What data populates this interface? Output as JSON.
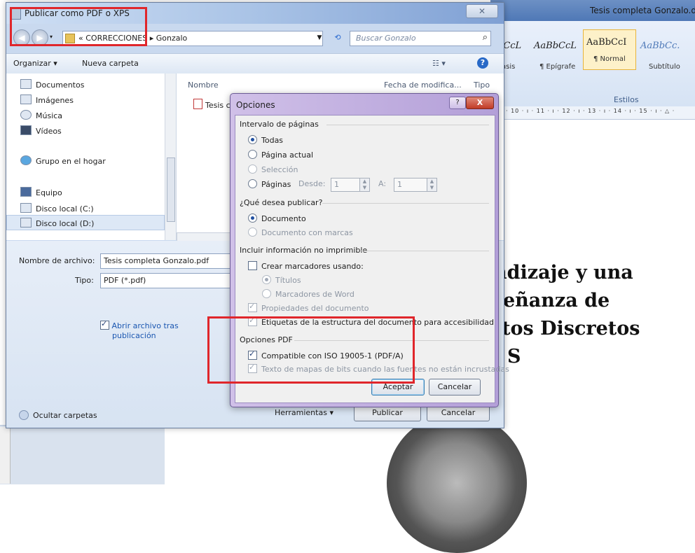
{
  "word": {
    "title": "Tesis completa Gonzalo.doc",
    "styles": [
      {
        "sample": "bCcL",
        "name": "asis"
      },
      {
        "sample": "AaBbCcL",
        "name": "¶ Epígrafe"
      },
      {
        "sample": "AaBbCcI",
        "name": "¶ Normal"
      },
      {
        "sample": "AaBbCc.",
        "name": "Subtítulo"
      }
    ],
    "styles_group": "Estilos",
    "ruler": "· 10 · ı · 11 · ı · 12 · ı · 13 · ı · 14 · ı · 15 · ı · △ ·",
    "heading_lines": [
      "ndizaje y una",
      "eñanza de",
      "tos Discretos",
      "S"
    ]
  },
  "save_dialog": {
    "title": "Publicar como PDF o XPS",
    "close": "✕",
    "breadcrumb": "« CORRECCIONES ▸ Gonzalo",
    "search_placeholder": "Buscar Gonzalo",
    "toolbar": {
      "organize": "Organizar ▾",
      "new_folder": "Nueva carpeta",
      "view": "☷ ▾",
      "help": "?"
    },
    "nav": [
      {
        "label": "Documentos",
        "icon": "documents-icon"
      },
      {
        "label": "Imágenes",
        "icon": "pictures-icon"
      },
      {
        "label": "Música",
        "icon": "music-icon"
      },
      {
        "label": "Vídeos",
        "icon": "videos-icon"
      },
      {
        "label": "Grupo en el hogar",
        "icon": "homegroup-icon"
      },
      {
        "label": "Equipo",
        "icon": "computer-icon"
      },
      {
        "label": "Disco local (C:)",
        "icon": "disk-c-icon"
      },
      {
        "label": "Disco local (D:)",
        "icon": "disk-d-icon"
      }
    ],
    "columns": {
      "name": "Nombre",
      "date": "Fecha de modifica...",
      "type": "Tipo"
    },
    "file": "Tesis c",
    "filename_label": "Nombre de archivo:",
    "filename_value": "Tesis completa Gonzalo.pdf",
    "type_label": "Tipo:",
    "type_value": "PDF (*.pdf)",
    "open_after": [
      "Abrir archivo tras",
      "publicación"
    ],
    "hide_folders": "Ocultar carpetas",
    "tools": "Herramientas  ▾",
    "publish": "Publicar",
    "cancel": "Cancelar"
  },
  "options_dialog": {
    "title": "Opciones",
    "help": "?",
    "close": "X",
    "page_range": {
      "group": "Intervalo de páginas",
      "all": "Todas",
      "current": "Página actual",
      "selection": "Selección",
      "pages": "Páginas",
      "from_label": "Desde:",
      "from_value": "1",
      "to_label": "A:",
      "to_value": "1"
    },
    "publish_what": {
      "group": "¿Qué desea publicar?",
      "document": "Documento",
      "with_markup": "Documento con marcas"
    },
    "nonprint": {
      "group": "Incluir información no imprimible",
      "bookmarks": "Crear marcadores usando:",
      "headings": "Títulos",
      "word_bookmarks": "Marcadores de Word",
      "properties": "Propiedades del documento",
      "tags": "Etiquetas de la estructura del documento para accesibilidad"
    },
    "pdf_options": {
      "group": "Opciones PDF",
      "iso": "Compatible con ISO 19005-1 (PDF/A)",
      "bitmap": "Texto de mapas de bits cuando las fuentes no están incrustadas"
    },
    "ok": "Aceptar",
    "cancel": "Cancelar"
  },
  "colors": {
    "highlight": "#e0262b",
    "link": "#1b57b1"
  }
}
